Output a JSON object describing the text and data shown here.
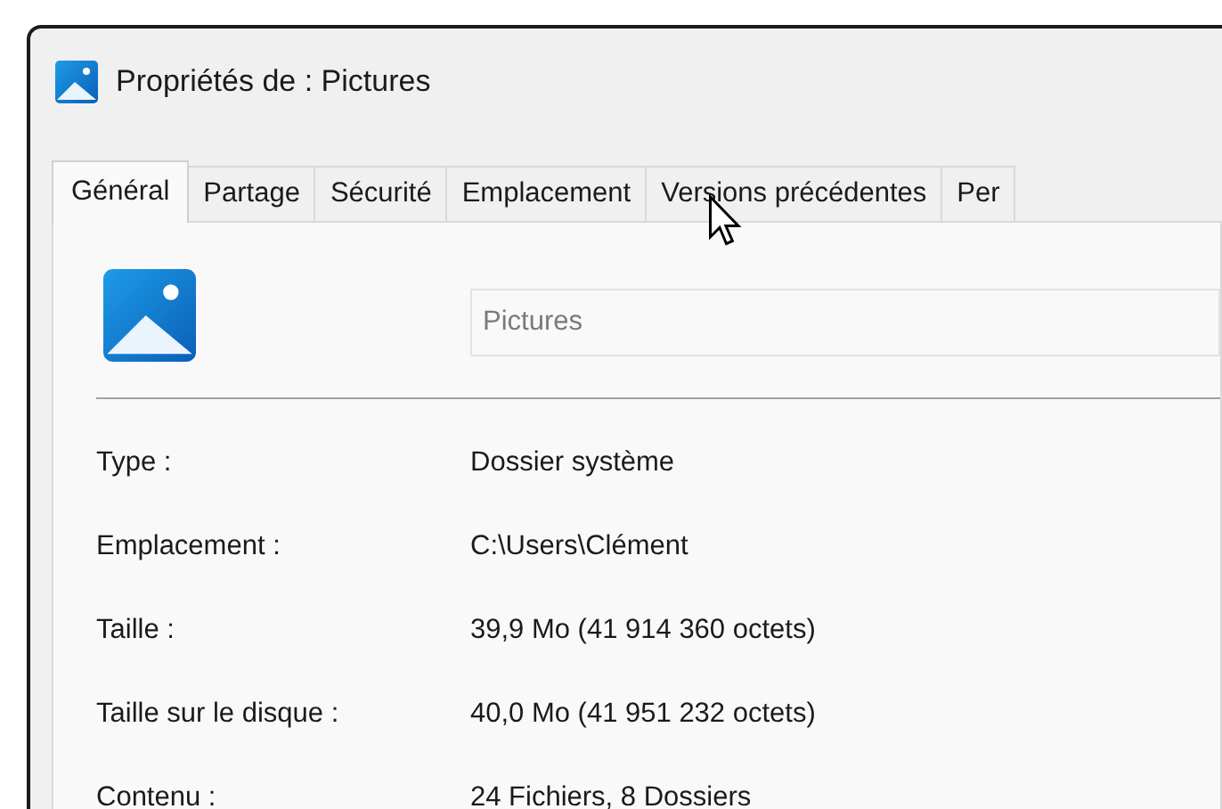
{
  "window": {
    "title": "Propriétés de : Pictures"
  },
  "tabs": [
    {
      "label": "Général",
      "selected": true
    },
    {
      "label": "Partage",
      "selected": false
    },
    {
      "label": "Sécurité",
      "selected": false
    },
    {
      "label": "Emplacement",
      "selected": false
    },
    {
      "label": "Versions précédentes",
      "selected": false
    },
    {
      "label": "Per",
      "selected": false
    }
  ],
  "name_field": {
    "value": "Pictures",
    "disabled": true
  },
  "properties": [
    {
      "label": "Type :",
      "value": "Dossier système"
    },
    {
      "label": "Emplacement :",
      "value": "C:\\Users\\Clément"
    },
    {
      "label": "Taille :",
      "value": "39,9 Mo (41 914 360 octets)"
    },
    {
      "label": "Taille sur le disque :",
      "value": "40,0 Mo (41 951 232 octets)"
    },
    {
      "label": "Contenu :",
      "value": "24 Fichiers, 8 Dossiers"
    }
  ]
}
